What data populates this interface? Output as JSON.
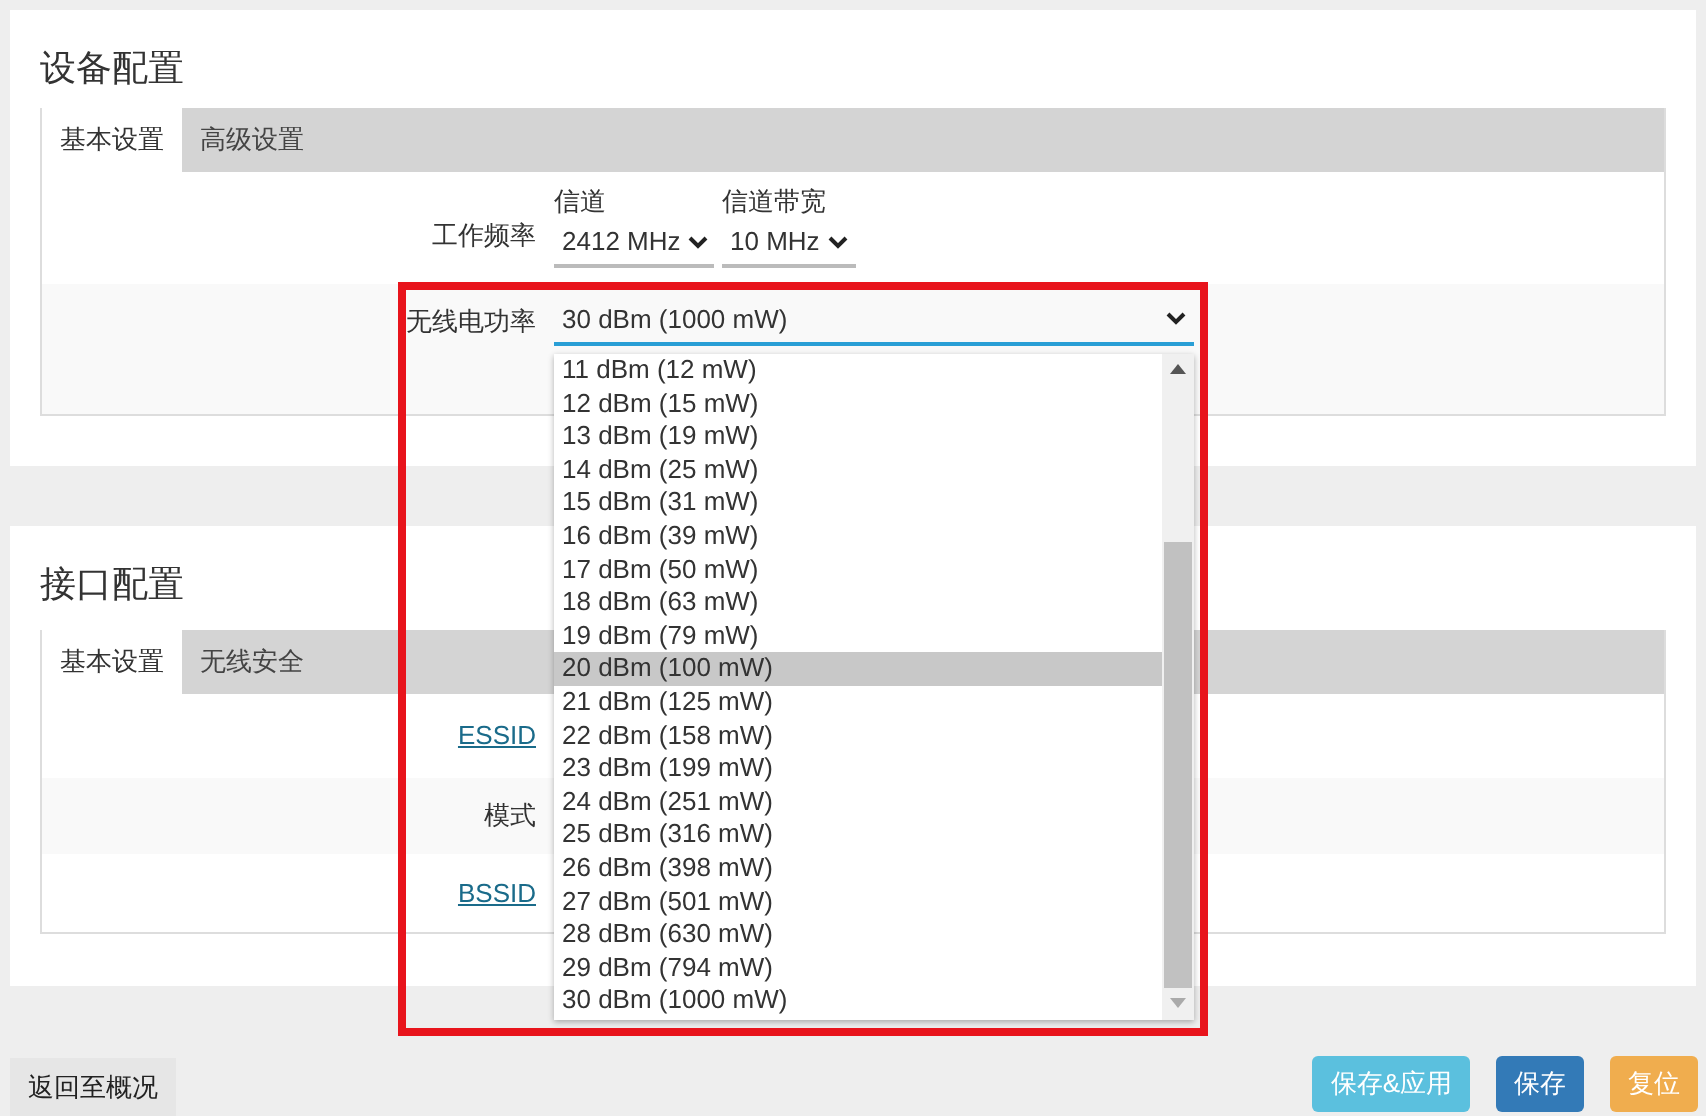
{
  "device_config": {
    "title": "设备配置",
    "tabs": [
      {
        "label": "基本设置",
        "selected": true
      },
      {
        "label": "高级设置",
        "selected": false
      }
    ],
    "frequency": {
      "label": "工作频率",
      "channel": {
        "label": "信道",
        "value": "2412 MHz"
      },
      "width": {
        "label": "信道带宽",
        "value": "10 MHz"
      }
    },
    "tx_power": {
      "label": "无线电功率",
      "value": "30 dBm (1000 mW)",
      "expanded": true,
      "options": [
        {
          "label": "11 dBm (12 mW)",
          "highlighted": false
        },
        {
          "label": "12 dBm (15 mW)",
          "highlighted": false
        },
        {
          "label": "13 dBm (19 mW)",
          "highlighted": false
        },
        {
          "label": "14 dBm (25 mW)",
          "highlighted": false
        },
        {
          "label": "15 dBm (31 mW)",
          "highlighted": false
        },
        {
          "label": "16 dBm (39 mW)",
          "highlighted": false
        },
        {
          "label": "17 dBm (50 mW)",
          "highlighted": false
        },
        {
          "label": "18 dBm (63 mW)",
          "highlighted": false
        },
        {
          "label": "19 dBm (79 mW)",
          "highlighted": false
        },
        {
          "label": "20 dBm (100 mW)",
          "highlighted": true
        },
        {
          "label": "21 dBm (125 mW)",
          "highlighted": false
        },
        {
          "label": "22 dBm (158 mW)",
          "highlighted": false
        },
        {
          "label": "23 dBm (199 mW)",
          "highlighted": false
        },
        {
          "label": "24 dBm (251 mW)",
          "highlighted": false
        },
        {
          "label": "25 dBm (316 mW)",
          "highlighted": false
        },
        {
          "label": "26 dBm (398 mW)",
          "highlighted": false
        },
        {
          "label": "27 dBm (501 mW)",
          "highlighted": false
        },
        {
          "label": "28 dBm (630 mW)",
          "highlighted": false
        },
        {
          "label": "29 dBm (794 mW)",
          "highlighted": false
        },
        {
          "label": "30 dBm (1000 mW)",
          "highlighted": false
        }
      ]
    }
  },
  "interface_config": {
    "title": "接口配置",
    "tabs": [
      {
        "label": "基本设置",
        "selected": true
      },
      {
        "label": "无线安全",
        "selected": false
      }
    ],
    "rows": [
      {
        "label": "ESSID",
        "kind": "link"
      },
      {
        "label": "模式",
        "kind": "text"
      },
      {
        "label": "BSSID",
        "kind": "link"
      }
    ]
  },
  "footer": {
    "back": "返回至概况",
    "buttons": [
      {
        "label": "保存&应用",
        "kind": "info"
      },
      {
        "label": "保存",
        "kind": "primary"
      },
      {
        "label": "复位",
        "kind": "warning"
      }
    ]
  }
}
